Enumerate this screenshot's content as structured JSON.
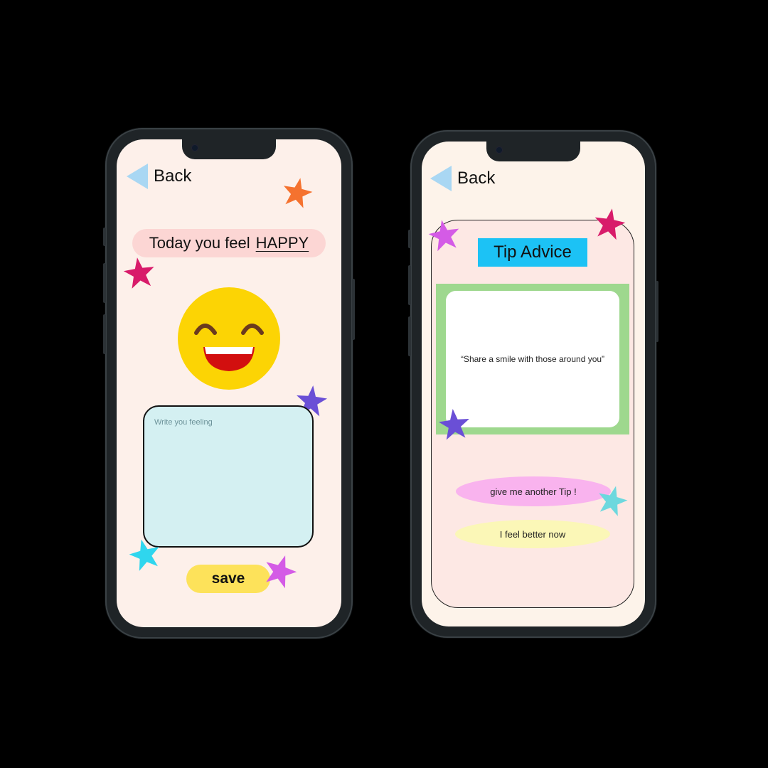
{
  "screen_feeling": {
    "back_label": "Back",
    "feel_prefix": "Today you feel",
    "mood": "HAPPY",
    "feeling_placeholder": "Write you feeling",
    "save_label": "save",
    "emoji": "grinning-face-smiling-eyes"
  },
  "screen_tip": {
    "back_label": "Back",
    "title": "Tip Advice",
    "tip_text": "“Share a smile with those around you”",
    "another_tip_label": "give me another Tip !",
    "feel_better_label": "I feel better now"
  },
  "colors": {
    "star_orange": "#f5722f",
    "star_pink": "#d81b6a",
    "star_purple": "#6a4fd6",
    "star_cyan": "#2fd6ee",
    "star_violet": "#d45be6",
    "star_teal": "#6dd8de"
  }
}
